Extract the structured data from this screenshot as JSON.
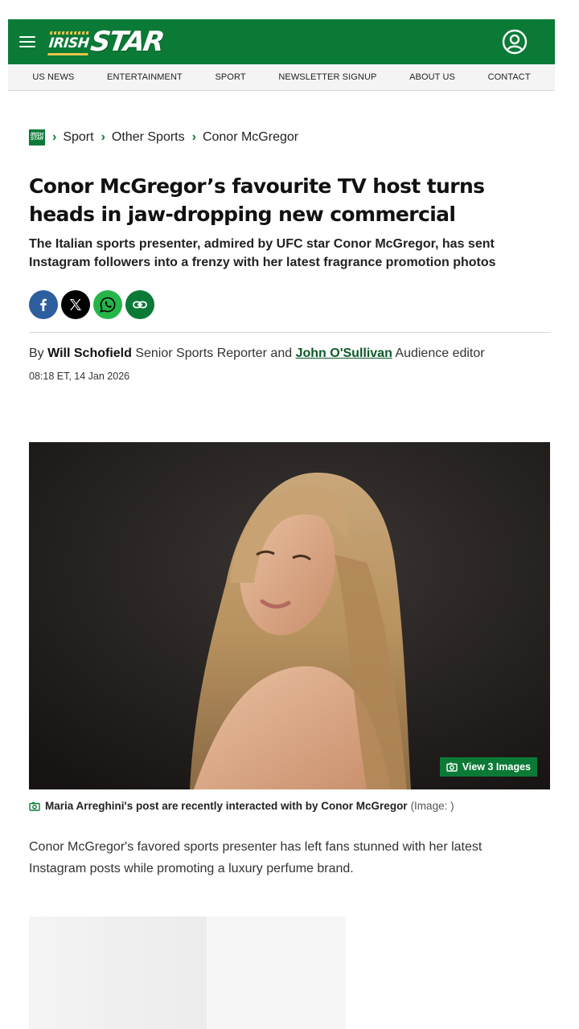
{
  "brand": {
    "logo_irish": "IRISH",
    "logo_star": "STAR",
    "primary_color": "#0b7a36"
  },
  "nav": [
    "US NEWS",
    "ENTERTAINMENT",
    "SPORT",
    "NEWSLETTER SIGNUP",
    "ABOUT US",
    "CONTACT"
  ],
  "breadcrumb": {
    "logo_text": "IRISH STAR",
    "items": [
      "Sport",
      "Other Sports",
      "Conor McGregor"
    ]
  },
  "article": {
    "headline": "Conor McGregor’s favourite TV host turns heads in jaw-dropping new commercial",
    "standfirst": "The Italian sports presenter, admired by UFC star Conor McGregor, has sent Instagram followers into a frenzy with her latest fragrance promotion photos",
    "byline": {
      "prefix": "By",
      "author1": "Will Schofield",
      "role1": "Senior Sports Reporter",
      "joiner": "and",
      "author2": "John O'Sullivan",
      "role2": "Audience editor"
    },
    "timestamp": "08:18 ET, 14 Jan 2026",
    "gallery_label": "View 3 Images",
    "caption": "Maria Arreghini's post are recently interacted with by Conor McGregor",
    "caption_credit": "(Image: )",
    "body": "Conor McGregor's favored sports presenter has left fans stunned with her latest Instagram posts while promoting a luxury perfume brand."
  },
  "share": [
    "facebook-icon",
    "x-icon",
    "whatsapp-icon",
    "link-icon"
  ]
}
